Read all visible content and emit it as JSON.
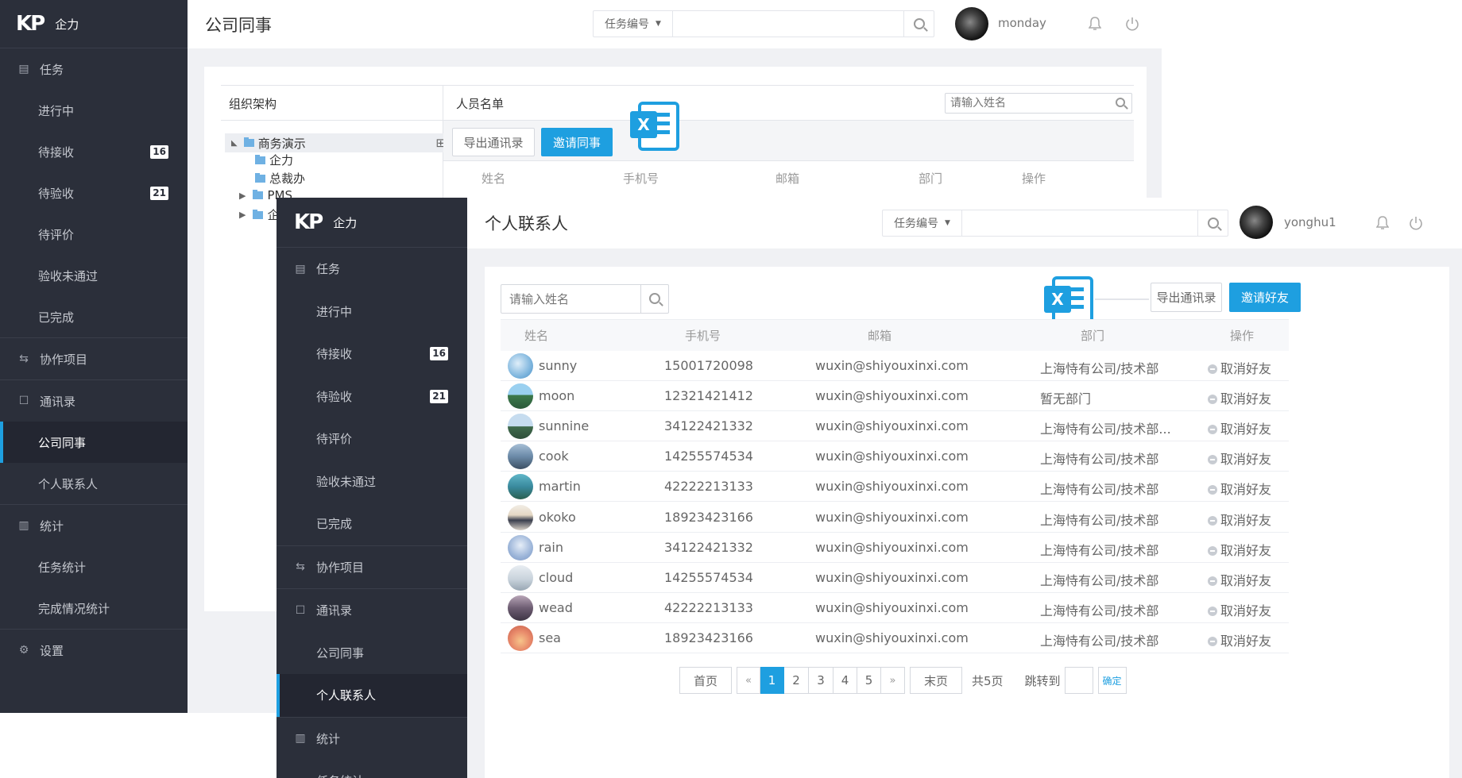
{
  "brand": {
    "logo_text": "KP",
    "app_name": "企力",
    "accent": "#1e9fe0"
  },
  "sidebar": {
    "groups": [
      {
        "label": "任务",
        "icon": "task-icon",
        "items": [
          {
            "label": "进行中"
          },
          {
            "label": "待接收",
            "badge": "16"
          },
          {
            "label": "待验收",
            "badge": "21"
          },
          {
            "label": "待评价"
          },
          {
            "label": "验收未通过"
          },
          {
            "label": "已完成"
          }
        ]
      },
      {
        "label": "协作项目",
        "icon": "swap-icon",
        "items": []
      },
      {
        "label": "通讯录",
        "icon": "contacts-icon",
        "items": [
          {
            "label": "公司同事"
          },
          {
            "label": "个人联系人"
          }
        ]
      },
      {
        "label": "统计",
        "icon": "chart-icon",
        "items": [
          {
            "label": "任务统计"
          },
          {
            "label": "完成情况统计"
          }
        ]
      },
      {
        "label": "设置",
        "icon": "gear-icon",
        "items": []
      }
    ]
  },
  "window_a": {
    "page_title": "公司同事",
    "search_select": "任务编号",
    "username": "monday",
    "org_panel_title": "组织架构",
    "tree": [
      {
        "label": "商务演示",
        "level": 0,
        "expanded": true,
        "selected": true
      },
      {
        "label": "企力",
        "level": 1
      },
      {
        "label": "总裁办",
        "level": 1
      },
      {
        "label": "PMS",
        "level": 1,
        "collapsed": true
      },
      {
        "label": "企",
        "level": 1,
        "collapsed": true
      }
    ],
    "member_panel_title": "人员名单",
    "name_search_placeholder": "请输入姓名",
    "export_button": "导出通讯录",
    "invite_button": "邀请同事",
    "columns": [
      "姓名",
      "手机号",
      "邮箱",
      "部门",
      "操作"
    ]
  },
  "window_b": {
    "page_title": "个人联系人",
    "search_select": "任务编号",
    "username": "yonghu1",
    "name_search_placeholder": "请输入姓名",
    "export_button": "导出通讯录",
    "invite_button": "邀请好友",
    "columns": [
      "姓名",
      "手机号",
      "邮箱",
      "部门",
      "操作"
    ],
    "rows": [
      {
        "name": "sunny",
        "phone": "15001720098",
        "email": "wuxin@shiyouxinxi.com",
        "dept": "上海恃有公司/技术部",
        "action": "取消好友"
      },
      {
        "name": "moon",
        "phone": "12321421412",
        "email": "wuxin@shiyouxinxi.com",
        "dept": "暂无部门",
        "action": "取消好友"
      },
      {
        "name": "sunnine",
        "phone": "34122421332",
        "email": "wuxin@shiyouxinxi.com",
        "dept": "上海恃有公司/技术部...",
        "action": "取消好友"
      },
      {
        "name": "cook",
        "phone": "14255574534",
        "email": "wuxin@shiyouxinxi.com",
        "dept": "上海恃有公司/技术部",
        "action": "取消好友"
      },
      {
        "name": "martin",
        "phone": "42222213133",
        "email": "wuxin@shiyouxinxi.com",
        "dept": "上海恃有公司/技术部",
        "action": "取消好友"
      },
      {
        "name": "okoko",
        "phone": "18923423166",
        "email": "wuxin@shiyouxinxi.com",
        "dept": "上海恃有公司/技术部",
        "action": "取消好友"
      },
      {
        "name": "rain",
        "phone": "34122421332",
        "email": "wuxin@shiyouxinxi.com",
        "dept": "上海恃有公司/技术部",
        "action": "取消好友"
      },
      {
        "name": "cloud",
        "phone": "14255574534",
        "email": "wuxin@shiyouxinxi.com",
        "dept": "上海恃有公司/技术部",
        "action": "取消好友"
      },
      {
        "name": "wead",
        "phone": "42222213133",
        "email": "wuxin@shiyouxinxi.com",
        "dept": "上海恃有公司/技术部",
        "action": "取消好友"
      },
      {
        "name": "sea",
        "phone": "18923423166",
        "email": "wuxin@shiyouxinxi.com",
        "dept": "上海恃有公司/技术部",
        "action": "取消好友"
      }
    ],
    "pagination": {
      "first": "首页",
      "prev": "«",
      "pages": [
        "1",
        "2",
        "3",
        "4",
        "5"
      ],
      "current": "1",
      "next": "»",
      "last": "末页",
      "total": "共5页",
      "jump_label": "跳转到",
      "confirm": "确定"
    }
  }
}
